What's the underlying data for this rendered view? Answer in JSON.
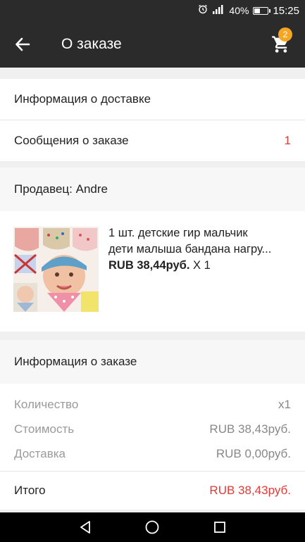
{
  "status_bar": {
    "battery_percent": "40%",
    "time": "15:25",
    "icons": [
      "alarm-icon",
      "signal-icon",
      "battery-icon"
    ]
  },
  "app_bar": {
    "title": "О заказе",
    "cart_count": "2",
    "icons": [
      "arrow-back-icon",
      "cart-icon"
    ]
  },
  "order_links": {
    "delivery_info_label": "Информация о доставке",
    "messages_label": "Сообщения о заказе",
    "messages_count": "1"
  },
  "seller": {
    "label": "Продавец: Andre"
  },
  "product": {
    "name_line1": "1 шт. детские гир мальчик",
    "name_line2": "дети малыша бандана нагру...",
    "price": "RUB 38,44руб.",
    "quantity": "X 1"
  },
  "order_info": {
    "heading": "Информация о заказе",
    "quantity_label": "Количество",
    "quantity_value": "x1",
    "cost_label": "Стоимость",
    "cost_value": "RUB 38,43руб.",
    "shipping_label": "Доставка",
    "shipping_value": "RUB 0,00руб.",
    "total_label": "Итого",
    "total_value": "RUB 38,43руб."
  },
  "colors": {
    "app_bar": "#2b2b2b",
    "accent_red": "#e53935",
    "badge": "#f5a623"
  },
  "nav_bar": {
    "icons": [
      "back-triangle-icon",
      "home-circle-icon",
      "recents-square-icon"
    ]
  }
}
